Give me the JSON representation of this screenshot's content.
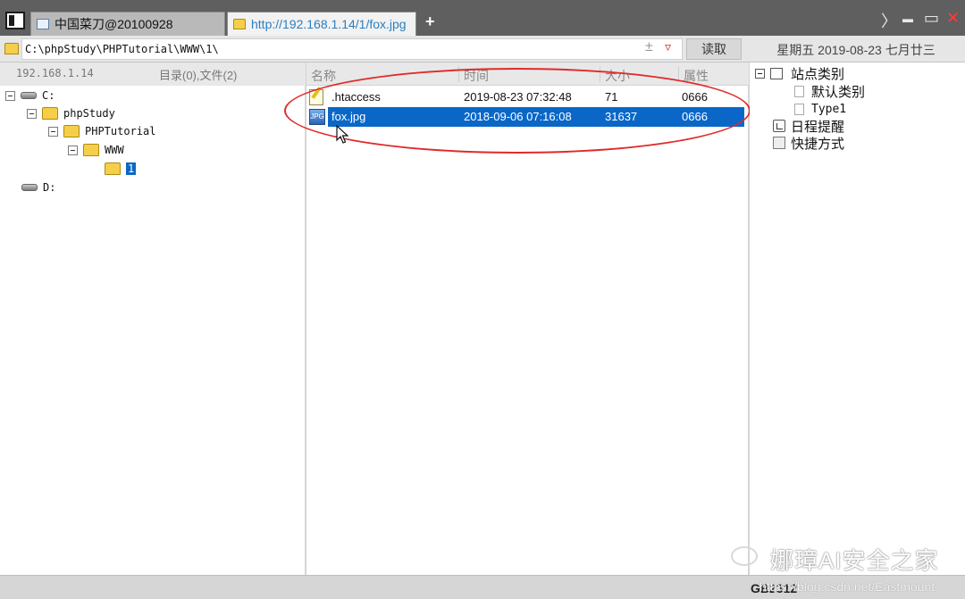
{
  "tabs": [
    {
      "label": "中国菜刀@20100928",
      "active": false
    },
    {
      "label": "http://192.168.1.14/1/fox.jpg",
      "active": true
    }
  ],
  "new_tab_symbol": "+",
  "window_controls": {
    "nav": "〉",
    "minimize": "▬",
    "maximize": "▭",
    "close": "✕"
  },
  "addressbar": {
    "path": "C:\\phpStudy\\PHPTutorial\\WWW\\1\\",
    "add_symbol": "±",
    "dropdown_symbol": "▿",
    "read_button": "读取",
    "date_text": "星期五 2019-08-23 七月廿三"
  },
  "left_panel": {
    "host": "192.168.1.14",
    "counts": "目录(0),文件(2)",
    "tree": [
      {
        "label": "C:",
        "type": "drive"
      },
      {
        "label": "phpStudy",
        "type": "folder"
      },
      {
        "label": "PHPTutorial",
        "type": "folder"
      },
      {
        "label": "WWW",
        "type": "folder"
      },
      {
        "label": "1",
        "type": "folder",
        "selected": true
      },
      {
        "label": "D:",
        "type": "drive"
      }
    ]
  },
  "file_list": {
    "columns": [
      "名称",
      "时间",
      "大小",
      "属性"
    ],
    "rows": [
      {
        "name": ".htaccess",
        "time": "2019-08-23 07:32:48",
        "size": "71",
        "attr": "0666",
        "icon": "htaccess-file-icon",
        "selected": false
      },
      {
        "name": "fox.jpg",
        "time": "2018-09-06 07:16:08",
        "size": "31637",
        "attr": "0666",
        "icon": "image-file-icon",
        "selected": true
      }
    ]
  },
  "right_panel": {
    "root": "站点类别",
    "children": [
      "默认类别",
      "Type1"
    ],
    "items": [
      "日程提醒",
      "快捷方式"
    ]
  },
  "status": {
    "encoding": "GB2312",
    "watermark_url": "https://blog.csdn.net/Eastmount"
  },
  "watermark": "娜璋AI安全之家",
  "colors": {
    "selection": "#0a67c8",
    "annotation": "#e02a2a",
    "tab_link": "#2a7fc0"
  }
}
